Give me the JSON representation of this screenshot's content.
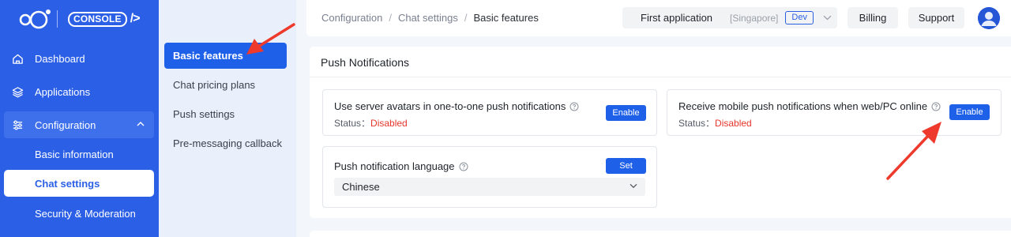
{
  "brand": {
    "logo": "console-logo",
    "console_label": "CONSOLE",
    "console_code": "/>"
  },
  "sidebar": {
    "items": [
      {
        "label": "Dashboard",
        "icon": "home-icon"
      },
      {
        "label": "Applications",
        "icon": "layers-icon"
      },
      {
        "label": "Configuration",
        "icon": "sliders-icon"
      }
    ],
    "configuration_sub": [
      {
        "label": "Basic information"
      },
      {
        "label": "Chat settings"
      },
      {
        "label": "Security & Moderation"
      }
    ]
  },
  "subnav": {
    "items": [
      {
        "label": "Basic features"
      },
      {
        "label": "Chat pricing plans"
      },
      {
        "label": "Push settings"
      },
      {
        "label": "Pre-messaging callback"
      }
    ]
  },
  "header": {
    "breadcrumb": [
      "Configuration",
      "Chat settings",
      "Basic features"
    ],
    "app_name": "First application",
    "app_region": "[Singapore]",
    "env_badge": "Dev",
    "billing_label": "Billing",
    "support_label": "Support"
  },
  "push": {
    "section_title": "Push Notifications",
    "server_avatars": {
      "title": "Use server avatars in one-to-one push notifications",
      "status_label": "Status：",
      "status_value": "Disabled",
      "button": "Enable"
    },
    "mobile_online": {
      "title": "Receive mobile push notifications when web/PC online",
      "status_label": "Status：",
      "status_value": "Disabled",
      "button": "Enable"
    },
    "language": {
      "title": "Push notification language",
      "button": "Set",
      "selected": "Chinese"
    }
  },
  "colors": {
    "sidebar": "#2b5fe6",
    "accent": "#1f60e8",
    "disabled": "#e5352b",
    "arrow": "#ee3a2c"
  }
}
